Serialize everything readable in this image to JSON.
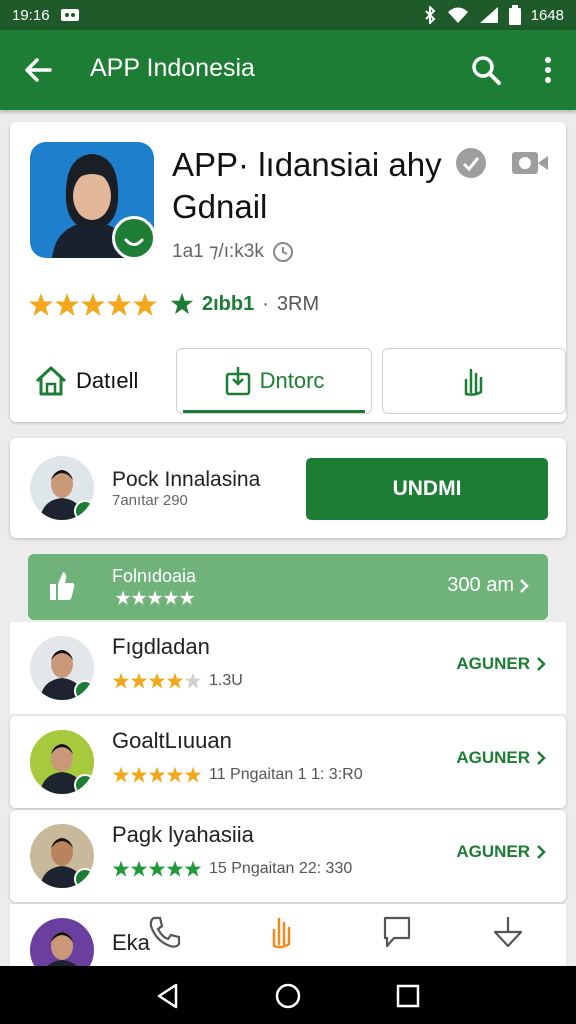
{
  "status_bar": {
    "time": "19:16",
    "battery_time": "1648"
  },
  "app_bar": {
    "title": "APP Indonesia"
  },
  "app": {
    "name": "APP· lıdansiai ahy Gdnail",
    "subinfo": "1a1 ⁊/ı:k3k",
    "rating_count": "2ıbb1",
    "downloads": "3RM"
  },
  "tabs": [
    {
      "label": "Datıell"
    },
    {
      "label": "Dntorc"
    },
    {
      "label": ""
    }
  ],
  "developer": {
    "name": "Pock Innalasina",
    "subtitle": "7anıtar 290",
    "install_label": "UNDMI"
  },
  "promo": {
    "title": "Folnıdoaia",
    "value": "300 am"
  },
  "list": [
    {
      "name": "Fıgdladan",
      "rating_text": "1.3U",
      "action": "AGUNER"
    },
    {
      "name": "GoaltLıuuan",
      "rating_text": "11 Pngaitan 1 1: 3:R0",
      "action": "AGUNER"
    },
    {
      "name": "Pagk lyahasiia",
      "rating_text": "15 Pngaitan 22: 330",
      "action": "AGUNER"
    },
    {
      "name": "Eka",
      "rating_text": "",
      "action": ""
    }
  ],
  "colors": {
    "primary": "#1e7d34",
    "status_bar": "#1f5a2a",
    "star": "#f3a81c",
    "promo": "#6fb37a"
  }
}
